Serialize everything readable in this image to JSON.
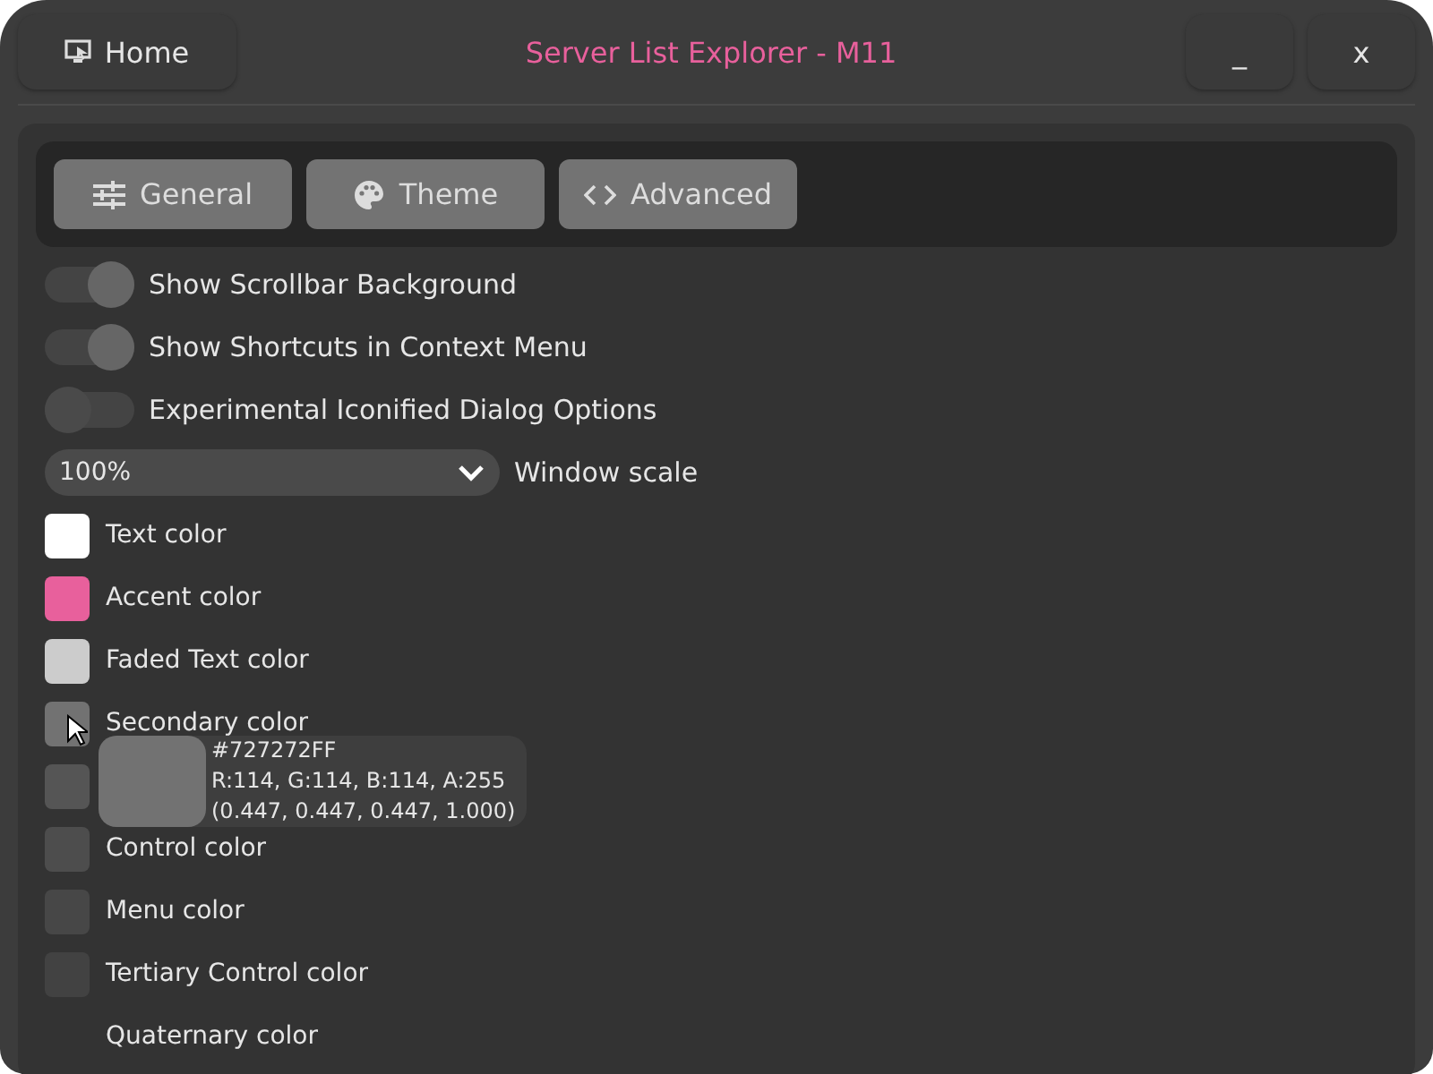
{
  "window": {
    "home_button": "Home",
    "title": "Server List Explorer - M11",
    "minimize": "_",
    "close": "x"
  },
  "tabs": [
    {
      "label": "General",
      "selected": false
    },
    {
      "label": "Theme",
      "selected": false
    },
    {
      "label": "Advanced",
      "selected": false
    }
  ],
  "toggles": [
    {
      "label": "Show Scrollbar Background",
      "on": true
    },
    {
      "label": "Show Shortcuts in Context Menu",
      "on": true
    },
    {
      "label": "Experimental Iconified Dialog Options",
      "on": false
    }
  ],
  "scale": {
    "value": "100%",
    "label": "Window scale"
  },
  "colors": [
    {
      "label": "Text color",
      "color": "#ffffff"
    },
    {
      "label": "Accent color",
      "color": "#e8609c"
    },
    {
      "label": "Faded Text color",
      "color": "#cccccc"
    },
    {
      "label": "Secondary color",
      "color": "#727272"
    },
    {
      "color": "#555555"
    },
    {
      "label": "Control color",
      "color": "#4d4d4d"
    },
    {
      "label": "Menu color",
      "color": "#474747"
    },
    {
      "label": "Tertiary Control color",
      "color": "#424242"
    },
    {
      "label": "Quaternary color"
    }
  ],
  "tooltip": {
    "color": "#727272",
    "hex": "#727272FF",
    "rgba": "R:114, G:114, B:114, A:255",
    "floats": "(0.447, 0.447, 0.447, 1.000)"
  }
}
